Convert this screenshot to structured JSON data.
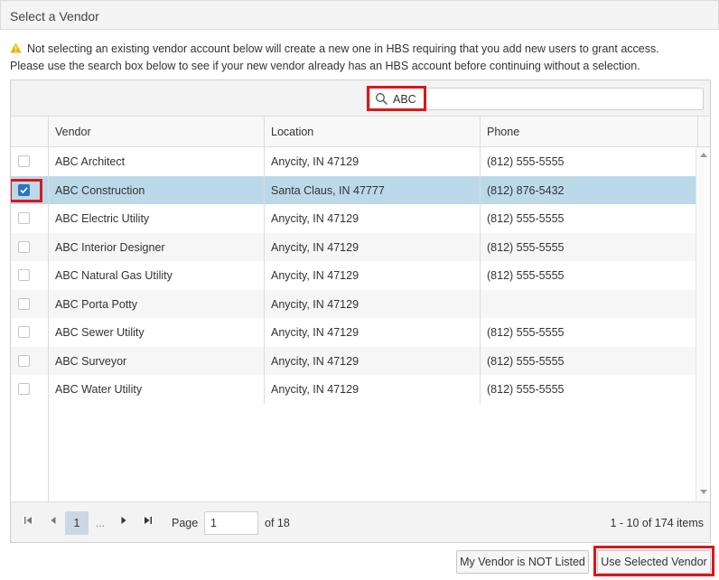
{
  "dialog": {
    "title": "Select a Vendor",
    "notice_line1": "Not selecting an existing vendor account below will create a new one in HBS requiring that you add new users to grant access.",
    "notice_line2": "Please use the search box below to see if your new vendor already has an HBS account before continuing without a selection."
  },
  "search": {
    "value": "ABC",
    "icon": "search-icon"
  },
  "table": {
    "columns": [
      "Vendor",
      "Location",
      "Phone"
    ],
    "rows": [
      {
        "vendor": "ABC Architect",
        "location": "Anycity, IN 47129",
        "phone": "(812) 555-5555",
        "checked": false
      },
      {
        "vendor": "ABC Construction",
        "location": "Santa Claus, IN 47777",
        "phone": "(812) 876-5432",
        "checked": true
      },
      {
        "vendor": "ABC Electric Utility",
        "location": "Anycity, IN 47129",
        "phone": "(812) 555-5555",
        "checked": false
      },
      {
        "vendor": "ABC Interior Designer",
        "location": "Anycity, IN 47129",
        "phone": "(812) 555-5555",
        "checked": false
      },
      {
        "vendor": "ABC Natural Gas Utility",
        "location": "Anycity, IN 47129",
        "phone": "(812) 555-5555",
        "checked": false
      },
      {
        "vendor": "ABC Porta Potty",
        "location": "Anycity, IN 47129",
        "phone": "",
        "checked": false
      },
      {
        "vendor": "ABC Sewer Utility",
        "location": "Anycity, IN 47129",
        "phone": "(812) 555-5555",
        "checked": false
      },
      {
        "vendor": "ABC Surveyor",
        "location": "Anycity, IN 47129",
        "phone": "(812) 555-5555",
        "checked": false
      },
      {
        "vendor": "ABC Water Utility",
        "location": "Anycity, IN 47129",
        "phone": "(812) 555-5555",
        "checked": false
      }
    ]
  },
  "pager": {
    "current_page": "1",
    "ellipsis": "...",
    "page_label": "Page",
    "page_input_value": "1",
    "of_label": "of 18",
    "summary": "1 - 10 of 174 items"
  },
  "buttons": {
    "not_listed": "My Vendor is NOT Listed",
    "use_selected": "Use Selected Vendor"
  },
  "colors": {
    "selected_row": "#bcd9ea",
    "highlight_box": "#d7191c",
    "checkbox_on": "#2a73c5",
    "warning": "#f0b400"
  }
}
